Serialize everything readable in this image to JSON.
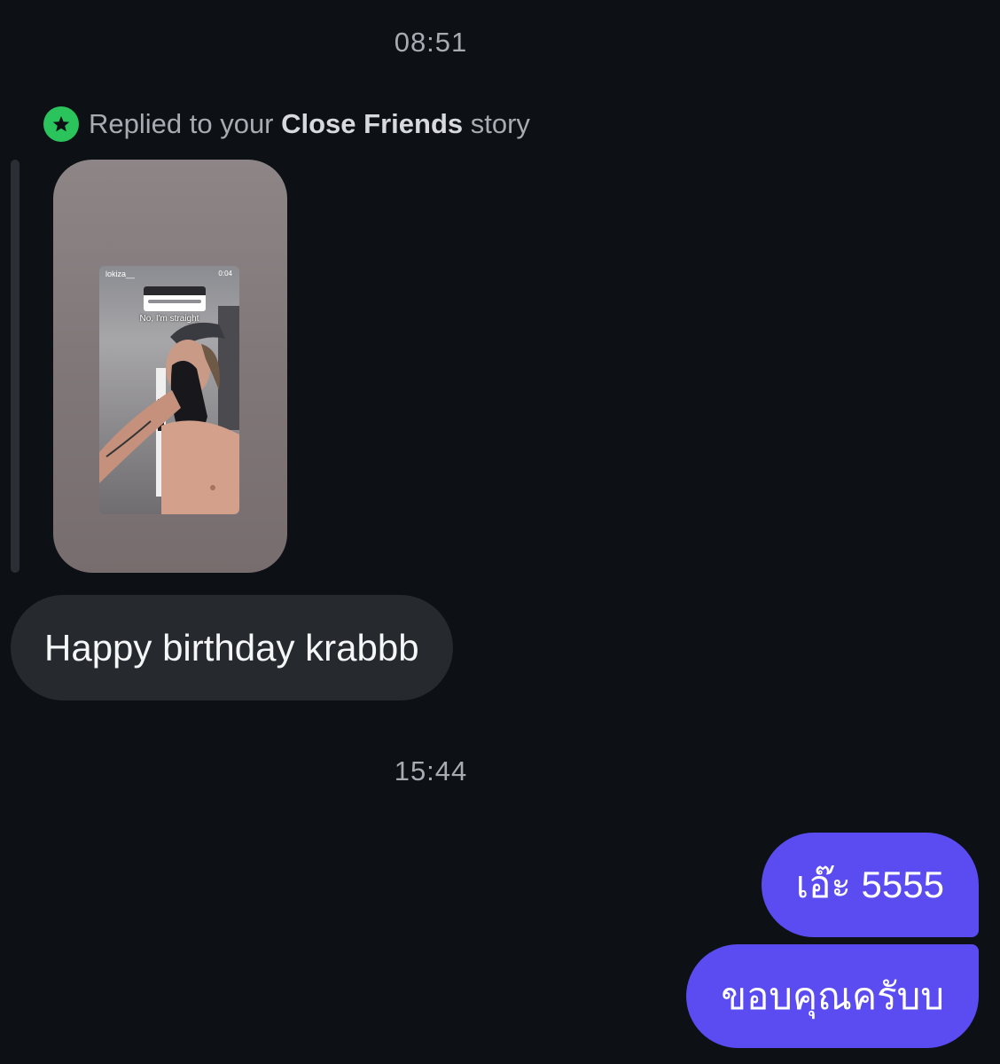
{
  "chat": {
    "timestamp_1": "08:51",
    "timestamp_2": "15:44",
    "reply_header": {
      "prefix": "Replied to your ",
      "emphasis": "Close Friends",
      "suffix": " story",
      "badge_color": "#2bc35c",
      "badge_icon": "star-icon"
    },
    "story": {
      "username": "lokiza__",
      "duration": "0:04",
      "caption": "No, I'm straight"
    },
    "messages": [
      {
        "direction": "incoming",
        "text": "Happy birthday krabbb"
      },
      {
        "direction": "outgoing",
        "text": "เอ๊ะ 5555"
      },
      {
        "direction": "outgoing",
        "text": "ขอบคุณครับบ"
      }
    ]
  },
  "colors": {
    "background": "#0d1015",
    "incoming_bubble": "#26292e",
    "outgoing_bubble": "#5b4cf2"
  }
}
